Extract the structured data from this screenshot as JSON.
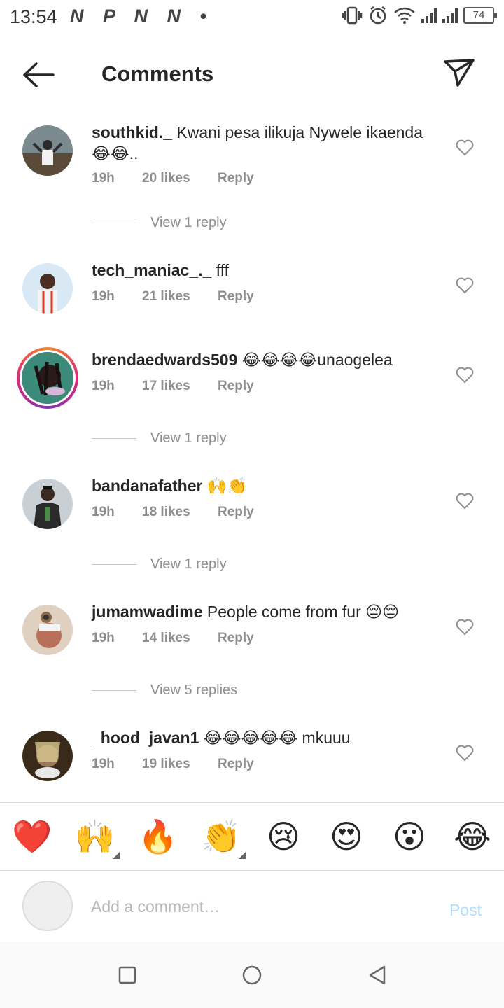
{
  "status_bar": {
    "time": "13:54",
    "notification_letters": "N P N N •",
    "battery": "74"
  },
  "header": {
    "title": "Comments"
  },
  "comments": [
    {
      "username": "southkid._",
      "text": "Kwani pesa ilikuja Nywele ikaenda 😂😂..",
      "time": "19h",
      "likes": "20 likes",
      "reply": "Reply",
      "view_replies": "View 1 reply"
    },
    {
      "username": "tech_maniac_._",
      "text": "fff",
      "time": "19h",
      "likes": "21 likes",
      "reply": "Reply"
    },
    {
      "username": "brendaedwards509",
      "text": "😂😂😂😂unaogelea",
      "time": "19h",
      "likes": "17 likes",
      "reply": "Reply",
      "view_replies": "View 1 reply"
    },
    {
      "username": "bandanafather",
      "text": "🙌👏",
      "time": "19h",
      "likes": "18 likes",
      "reply": "Reply",
      "view_replies": "View 1 reply"
    },
    {
      "username": "jumamwadime",
      "text": "People come from fur 😔😔",
      "time": "19h",
      "likes": "14 likes",
      "reply": "Reply",
      "view_replies": "View 5 replies"
    },
    {
      "username": "_hood_javan1",
      "text": "😂😂😂😂😂 mkuuu",
      "time": "19h",
      "likes": "19 likes",
      "reply": "Reply"
    }
  ],
  "emoji_bar": [
    "❤️",
    "🙌",
    "🔥",
    "👏",
    "😢",
    "😍",
    "😮",
    "😂"
  ],
  "input": {
    "placeholder": "Add a comment…",
    "post_label": "Post"
  },
  "icons": {
    "back": "back-arrow-icon",
    "share": "paper-plane-icon",
    "like": "heart-outline-icon",
    "nav_recent": "square-icon",
    "nav_home": "circle-icon",
    "nav_back": "triangle-back-icon"
  }
}
